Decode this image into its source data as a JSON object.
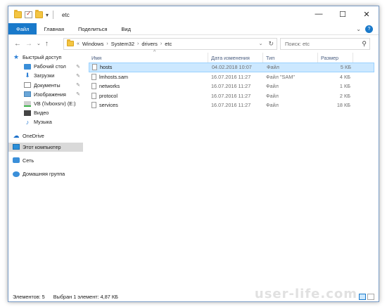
{
  "window": {
    "title": "etc",
    "qa_dropdown": "▾",
    "controls": {
      "minimize": "—",
      "maximize": "☐",
      "close": "✕"
    }
  },
  "ribbon": {
    "tabs": [
      "Файл",
      "Главная",
      "Поделиться",
      "Вид"
    ],
    "collapse_glyph": "⌄",
    "help_glyph": "?"
  },
  "address": {
    "back": "←",
    "forward": "→",
    "history": "⌄",
    "up": "↑",
    "lead_glyph": "«",
    "crumbs": [
      "Windows",
      "System32",
      "drivers",
      "etc"
    ],
    "crumb_sep": "›",
    "dropdown": "⌄",
    "refresh": "↻"
  },
  "search": {
    "placeholder": "Поиск: etc",
    "icon": "search-icon"
  },
  "navpane": {
    "quick_access": "Быстрый доступ",
    "items": [
      {
        "label": "Рабочий стол",
        "icon": "desktop-icon",
        "pinned": true
      },
      {
        "label": "Загрузки",
        "icon": "download-icon",
        "pinned": true
      },
      {
        "label": "Документы",
        "icon": "documents-icon",
        "pinned": true
      },
      {
        "label": "Изображения",
        "icon": "pictures-icon",
        "pinned": true
      },
      {
        "label": "VB (\\\\vboxsrv) (E:)",
        "icon": "network-drive-icon",
        "pinned": false
      },
      {
        "label": "Видео",
        "icon": "video-icon",
        "pinned": false
      },
      {
        "label": "Музыка",
        "icon": "music-icon",
        "pinned": false
      }
    ],
    "pin_glyph": "📌",
    "onedrive": "OneDrive",
    "this_pc": "Этот компьютер",
    "network": "Сеть",
    "homegroup": "Домашняя группа"
  },
  "list": {
    "sort_glyph": "^",
    "columns": [
      "Имя",
      "Дата изменения",
      "Тип",
      "Размер"
    ],
    "rows": [
      {
        "name": "hosts",
        "date": "04.02.2018 10:07",
        "type": "Файл",
        "size": "5 КБ",
        "selected": true
      },
      {
        "name": "lmhosts.sam",
        "date": "16.07.2016 11:27",
        "type": "Файл \"SAM\"",
        "size": "4 КБ",
        "selected": false
      },
      {
        "name": "networks",
        "date": "16.07.2016 11:27",
        "type": "Файл",
        "size": "1 КБ",
        "selected": false
      },
      {
        "name": "protocol",
        "date": "16.07.2016 11:27",
        "type": "Файл",
        "size": "2 КБ",
        "selected": false
      },
      {
        "name": "services",
        "date": "16.07.2016 11:27",
        "type": "Файл",
        "size": "18 КБ",
        "selected": false
      }
    ]
  },
  "status": {
    "count": "Элементов: 5",
    "selected": "Выбран 1 элемент: 4,87 КБ"
  },
  "watermark": "user-life.com",
  "colors": {
    "accent": "#1979ca",
    "selection": "#cce8ff",
    "selection_border": "#99d1ff"
  }
}
